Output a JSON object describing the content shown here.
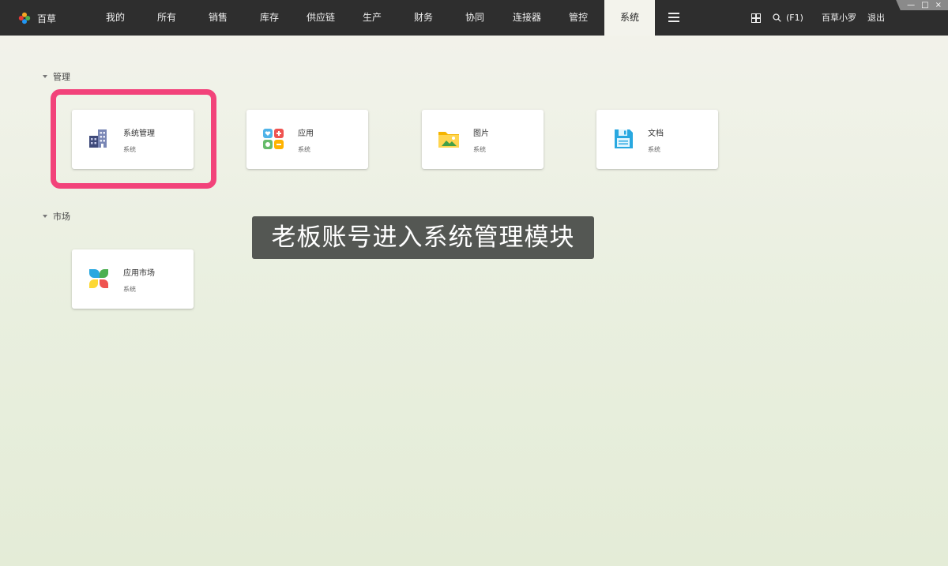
{
  "app": {
    "logo_text": "百草"
  },
  "nav": {
    "items": [
      {
        "label": "我的"
      },
      {
        "label": "所有"
      },
      {
        "label": "销售"
      },
      {
        "label": "库存"
      },
      {
        "label": "供应链"
      },
      {
        "label": "生产"
      },
      {
        "label": "财务"
      },
      {
        "label": "协同"
      },
      {
        "label": "连接器"
      },
      {
        "label": "管控"
      },
      {
        "label": "系统",
        "active": true
      }
    ]
  },
  "header": {
    "search_label": "(F1)",
    "user_name": "百草小罗",
    "logout_label": "退出"
  },
  "window_controls": {
    "minimize": "—",
    "maximize": "□",
    "close": "×"
  },
  "sections": [
    {
      "title": "管理",
      "cards": [
        {
          "name": "系统管理",
          "sub": "系统",
          "icon": "building-icon"
        },
        {
          "name": "应用",
          "sub": "系统",
          "icon": "apps-icon"
        },
        {
          "name": "图片",
          "sub": "系统",
          "icon": "image-folder-icon"
        },
        {
          "name": "文档",
          "sub": "系统",
          "icon": "floppy-disk-icon"
        }
      ]
    },
    {
      "title": "市场",
      "cards": [
        {
          "name": "应用市场",
          "sub": "系统",
          "icon": "app-market-icon"
        }
      ]
    }
  ],
  "overlay_caption": "老板账号进入系统管理模块",
  "colors": {
    "topbar": "#2e2e2e",
    "highlight": "#f2437a"
  }
}
